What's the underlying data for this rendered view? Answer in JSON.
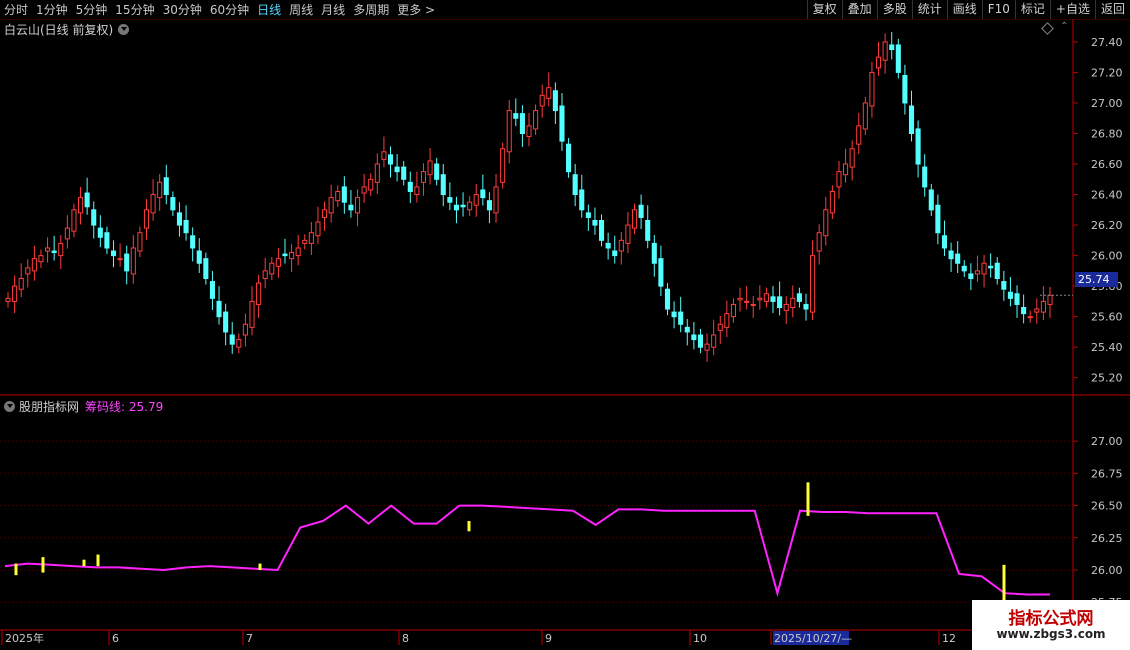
{
  "toolbar": {
    "periods": [
      "分时",
      "1分钟",
      "5分钟",
      "15分钟",
      "30分钟",
      "60分钟",
      "日线",
      "周线",
      "月线",
      "多周期",
      "更多 >"
    ],
    "active_period": "日线",
    "buttons": [
      "复权",
      "叠加",
      "多股",
      "统计",
      "画线",
      "F10",
      "标记",
      "+自选",
      "返回"
    ]
  },
  "main_title": "白云山(日线 前复权)",
  "sub_panel": {
    "name": "股朋指标网",
    "indicator": "筹码线: 25.79"
  },
  "current_price": "25.74",
  "watermark": {
    "line1": "指标公式网",
    "line2": "www.zbgs3.com"
  },
  "colors": {
    "up": "#ff3c3c",
    "down": "#54ffff",
    "chip_line": "#ff22ff",
    "marker": "#ffff33",
    "axis": "#c00000"
  },
  "chart_data": [
    {
      "type": "candlestick",
      "ylim": [
        25.1,
        27.55
      ],
      "yticks": [
        "27.40",
        "27.20",
        "27.00",
        "26.80",
        "26.60",
        "26.40",
        "26.20",
        "26.00",
        "25.80",
        "25.60",
        "25.40",
        "25.20"
      ],
      "x_labels": [
        "2025年",
        "6",
        "7",
        "8",
        "9",
        "10",
        "2025/10/27/—",
        "12"
      ],
      "close_approx": [
        25.72,
        25.8,
        25.85,
        25.92,
        25.98,
        26.0,
        26.05,
        26.02,
        26.08,
        26.18,
        26.3,
        26.38,
        26.32,
        26.2,
        26.12,
        26.05,
        26.0,
        25.98,
        25.9,
        26.05,
        26.15,
        26.3,
        26.4,
        26.48,
        26.4,
        26.3,
        26.2,
        26.15,
        26.05,
        25.95,
        25.85,
        25.72,
        25.6,
        25.5,
        25.42,
        25.45,
        25.55,
        25.7,
        25.82,
        25.9,
        25.95,
        25.98,
        26.0,
        26.02,
        26.05,
        26.1,
        26.15,
        26.22,
        26.3,
        26.38,
        26.42,
        26.35,
        26.3,
        26.38,
        26.45,
        26.5,
        26.6,
        26.68,
        26.6,
        26.55,
        26.5,
        26.42,
        26.45,
        26.55,
        26.62,
        26.5,
        26.4,
        26.35,
        26.3,
        26.32,
        26.35,
        26.4,
        26.38,
        26.3,
        26.45,
        26.7,
        26.95,
        26.9,
        26.8,
        26.85,
        26.95,
        27.05,
        27.1,
        26.95,
        26.75,
        26.55,
        26.4,
        26.3,
        26.25,
        26.2,
        26.1,
        26.05,
        26.0,
        26.1,
        26.2,
        26.3,
        26.25,
        26.1,
        25.95,
        25.8,
        25.65,
        25.6,
        25.55,
        25.5,
        25.45,
        25.4,
        25.42,
        25.48,
        25.55,
        25.62,
        25.68,
        25.72,
        25.7,
        25.68,
        25.72,
        25.75,
        25.7,
        25.66,
        25.68,
        25.72,
        25.7,
        25.65,
        26.0,
        26.15,
        26.3,
        26.42,
        26.55,
        26.6,
        26.7,
        26.85,
        27.0,
        27.2,
        27.3,
        27.4,
        27.35,
        27.2,
        27.0,
        26.8,
        26.6,
        26.45,
        26.3,
        26.15,
        26.05,
        25.98,
        25.95,
        25.9,
        25.85,
        25.9,
        25.95,
        25.92,
        25.85,
        25.78,
        25.72,
        25.68,
        25.62,
        25.6,
        25.65,
        25.7,
        25.74
      ]
    },
    {
      "type": "line",
      "ylim": [
        25.55,
        27.35
      ],
      "yticks": [
        "27.00",
        "26.75",
        "26.50",
        "26.25",
        "26.00",
        "25.75"
      ],
      "series": [
        {
          "name": "筹码线",
          "values": [
            26.03,
            26.05,
            26.04,
            26.03,
            26.02,
            26.02,
            26.01,
            26.0,
            26.02,
            26.03,
            26.02,
            26.01,
            26.0,
            26.33,
            26.38,
            26.5,
            26.36,
            26.5,
            26.36,
            26.36,
            26.5,
            26.5,
            26.49,
            26.48,
            26.47,
            26.46,
            26.35,
            26.47,
            26.47,
            26.46,
            26.46,
            26.46,
            26.46,
            26.46,
            25.82,
            26.46,
            26.45,
            26.45,
            26.44,
            26.44,
            26.44,
            26.44,
            25.97,
            25.95,
            25.82,
            25.81,
            25.81
          ]
        }
      ],
      "markers_up": [
        26.0,
        26.05,
        26.08,
        26.25,
        26.4,
        26.55,
        25.95
      ],
      "markers_down": [
        25.98,
        26.1,
        26.05,
        26.0,
        26.3,
        25.9
      ]
    }
  ]
}
